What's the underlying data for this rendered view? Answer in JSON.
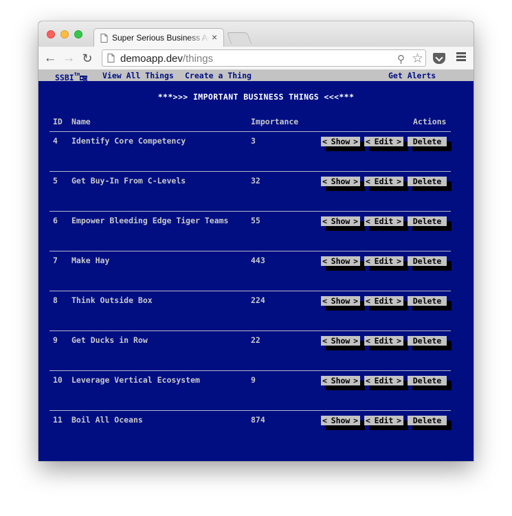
{
  "browser": {
    "tab_title": "Super Serious Business Ap",
    "url_host": "demoapp.dev",
    "url_path": "/things"
  },
  "nav": {
    "logo": "SSBI",
    "logo_mark": "tm",
    "view_all": "View All Things",
    "create": "Create a Thing",
    "alerts": "Get Alerts"
  },
  "main": {
    "title": "***>>> IMPORTANT BUSINESS THINGS <<<***",
    "headers": {
      "id": "ID",
      "name": "Name",
      "importance": "Importance",
      "actions": "Actions"
    },
    "action_labels": {
      "show": "Show",
      "edit": "Edit",
      "delete": "Delete"
    },
    "rows": [
      {
        "id": "4",
        "name": "Identify Core Competency",
        "importance": "3"
      },
      {
        "id": "5",
        "name": "Get Buy-In From C-Levels",
        "importance": "32"
      },
      {
        "id": "6",
        "name": "Empower Bleeding Edge Tiger Teams",
        "importance": "55"
      },
      {
        "id": "7",
        "name": "Make Hay",
        "importance": "443"
      },
      {
        "id": "8",
        "name": "Think Outside Box",
        "importance": "224"
      },
      {
        "id": "9",
        "name": "Get Ducks in Row",
        "importance": "22"
      },
      {
        "id": "10",
        "name": "Leverage Vertical Ecosystem",
        "importance": "9"
      },
      {
        "id": "11",
        "name": "Boil All Oceans",
        "importance": "874"
      }
    ]
  },
  "colors": {
    "background": "#000e82",
    "nav_bar": "#c3c3c3",
    "button": "#c3c3c3",
    "text": "#c9c9c9"
  }
}
